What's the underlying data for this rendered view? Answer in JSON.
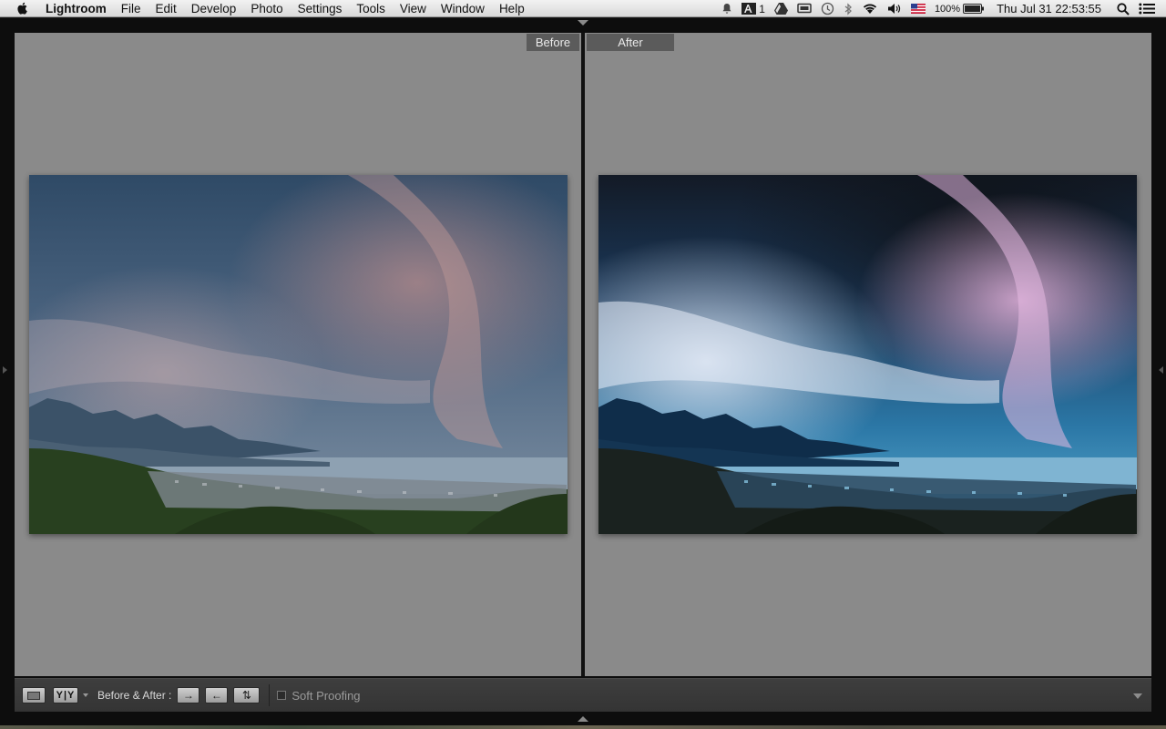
{
  "menubar": {
    "app_name": "Lightroom",
    "items": [
      "File",
      "Edit",
      "Develop",
      "Photo",
      "Settings",
      "Tools",
      "View",
      "Window",
      "Help"
    ],
    "status": {
      "adobe_count": "1",
      "battery": "100%",
      "datetime": "Thu Jul 31  22:53:55"
    }
  },
  "panes": {
    "before_label": "Before",
    "after_label": "After"
  },
  "toolbar": {
    "view_toggle": "Y|Y",
    "before_after_label": "Before & After :",
    "copy_before_to_after": "→",
    "copy_after_to_before": "←",
    "swap": "⇅",
    "soft_proofing_label": "Soft Proofing",
    "soft_proofing_checked": false
  },
  "colors": {
    "pane_background": "#8a8a8a",
    "label_background": "#5b5b5b",
    "toolbar_background": "#3a3a3a"
  },
  "icons": {
    "apple": "apple-icon",
    "notifications": "bell-icon",
    "adobe": "adobe-icon",
    "drive": "google-drive-icon",
    "display": "display-icon",
    "time_machine": "time-machine-icon",
    "bluetooth": "bluetooth-icon",
    "wifi": "wifi-icon",
    "volume": "volume-icon",
    "flag": "us-flag-icon",
    "battery": "battery-icon",
    "spotlight": "search-icon",
    "list": "list-icon"
  }
}
